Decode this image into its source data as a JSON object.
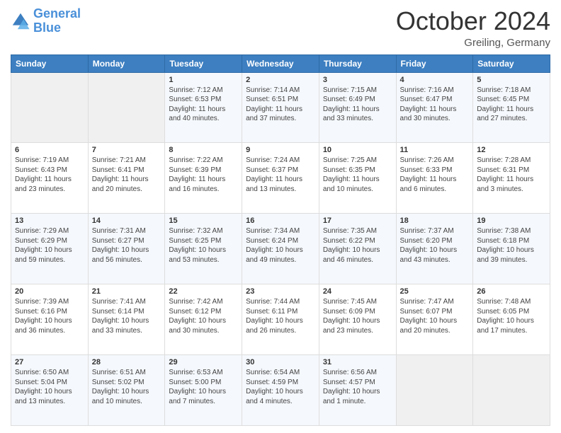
{
  "logo": {
    "line1": "General",
    "line2": "Blue"
  },
  "title": "October 2024",
  "location": "Greiling, Germany",
  "days_of_week": [
    "Sunday",
    "Monday",
    "Tuesday",
    "Wednesday",
    "Thursday",
    "Friday",
    "Saturday"
  ],
  "weeks": [
    [
      {
        "day": "",
        "info": ""
      },
      {
        "day": "",
        "info": ""
      },
      {
        "day": "1",
        "info": "Sunrise: 7:12 AM\nSunset: 6:53 PM\nDaylight: 11 hours and 40 minutes."
      },
      {
        "day": "2",
        "info": "Sunrise: 7:14 AM\nSunset: 6:51 PM\nDaylight: 11 hours and 37 minutes."
      },
      {
        "day": "3",
        "info": "Sunrise: 7:15 AM\nSunset: 6:49 PM\nDaylight: 11 hours and 33 minutes."
      },
      {
        "day": "4",
        "info": "Sunrise: 7:16 AM\nSunset: 6:47 PM\nDaylight: 11 hours and 30 minutes."
      },
      {
        "day": "5",
        "info": "Sunrise: 7:18 AM\nSunset: 6:45 PM\nDaylight: 11 hours and 27 minutes."
      }
    ],
    [
      {
        "day": "6",
        "info": "Sunrise: 7:19 AM\nSunset: 6:43 PM\nDaylight: 11 hours and 23 minutes."
      },
      {
        "day": "7",
        "info": "Sunrise: 7:21 AM\nSunset: 6:41 PM\nDaylight: 11 hours and 20 minutes."
      },
      {
        "day": "8",
        "info": "Sunrise: 7:22 AM\nSunset: 6:39 PM\nDaylight: 11 hours and 16 minutes."
      },
      {
        "day": "9",
        "info": "Sunrise: 7:24 AM\nSunset: 6:37 PM\nDaylight: 11 hours and 13 minutes."
      },
      {
        "day": "10",
        "info": "Sunrise: 7:25 AM\nSunset: 6:35 PM\nDaylight: 11 hours and 10 minutes."
      },
      {
        "day": "11",
        "info": "Sunrise: 7:26 AM\nSunset: 6:33 PM\nDaylight: 11 hours and 6 minutes."
      },
      {
        "day": "12",
        "info": "Sunrise: 7:28 AM\nSunset: 6:31 PM\nDaylight: 11 hours and 3 minutes."
      }
    ],
    [
      {
        "day": "13",
        "info": "Sunrise: 7:29 AM\nSunset: 6:29 PM\nDaylight: 10 hours and 59 minutes."
      },
      {
        "day": "14",
        "info": "Sunrise: 7:31 AM\nSunset: 6:27 PM\nDaylight: 10 hours and 56 minutes."
      },
      {
        "day": "15",
        "info": "Sunrise: 7:32 AM\nSunset: 6:25 PM\nDaylight: 10 hours and 53 minutes."
      },
      {
        "day": "16",
        "info": "Sunrise: 7:34 AM\nSunset: 6:24 PM\nDaylight: 10 hours and 49 minutes."
      },
      {
        "day": "17",
        "info": "Sunrise: 7:35 AM\nSunset: 6:22 PM\nDaylight: 10 hours and 46 minutes."
      },
      {
        "day": "18",
        "info": "Sunrise: 7:37 AM\nSunset: 6:20 PM\nDaylight: 10 hours and 43 minutes."
      },
      {
        "day": "19",
        "info": "Sunrise: 7:38 AM\nSunset: 6:18 PM\nDaylight: 10 hours and 39 minutes."
      }
    ],
    [
      {
        "day": "20",
        "info": "Sunrise: 7:39 AM\nSunset: 6:16 PM\nDaylight: 10 hours and 36 minutes."
      },
      {
        "day": "21",
        "info": "Sunrise: 7:41 AM\nSunset: 6:14 PM\nDaylight: 10 hours and 33 minutes."
      },
      {
        "day": "22",
        "info": "Sunrise: 7:42 AM\nSunset: 6:12 PM\nDaylight: 10 hours and 30 minutes."
      },
      {
        "day": "23",
        "info": "Sunrise: 7:44 AM\nSunset: 6:11 PM\nDaylight: 10 hours and 26 minutes."
      },
      {
        "day": "24",
        "info": "Sunrise: 7:45 AM\nSunset: 6:09 PM\nDaylight: 10 hours and 23 minutes."
      },
      {
        "day": "25",
        "info": "Sunrise: 7:47 AM\nSunset: 6:07 PM\nDaylight: 10 hours and 20 minutes."
      },
      {
        "day": "26",
        "info": "Sunrise: 7:48 AM\nSunset: 6:05 PM\nDaylight: 10 hours and 17 minutes."
      }
    ],
    [
      {
        "day": "27",
        "info": "Sunrise: 6:50 AM\nSunset: 5:04 PM\nDaylight: 10 hours and 13 minutes."
      },
      {
        "day": "28",
        "info": "Sunrise: 6:51 AM\nSunset: 5:02 PM\nDaylight: 10 hours and 10 minutes."
      },
      {
        "day": "29",
        "info": "Sunrise: 6:53 AM\nSunset: 5:00 PM\nDaylight: 10 hours and 7 minutes."
      },
      {
        "day": "30",
        "info": "Sunrise: 6:54 AM\nSunset: 4:59 PM\nDaylight: 10 hours and 4 minutes."
      },
      {
        "day": "31",
        "info": "Sunrise: 6:56 AM\nSunset: 4:57 PM\nDaylight: 10 hours and 1 minute."
      },
      {
        "day": "",
        "info": ""
      },
      {
        "day": "",
        "info": ""
      }
    ]
  ]
}
